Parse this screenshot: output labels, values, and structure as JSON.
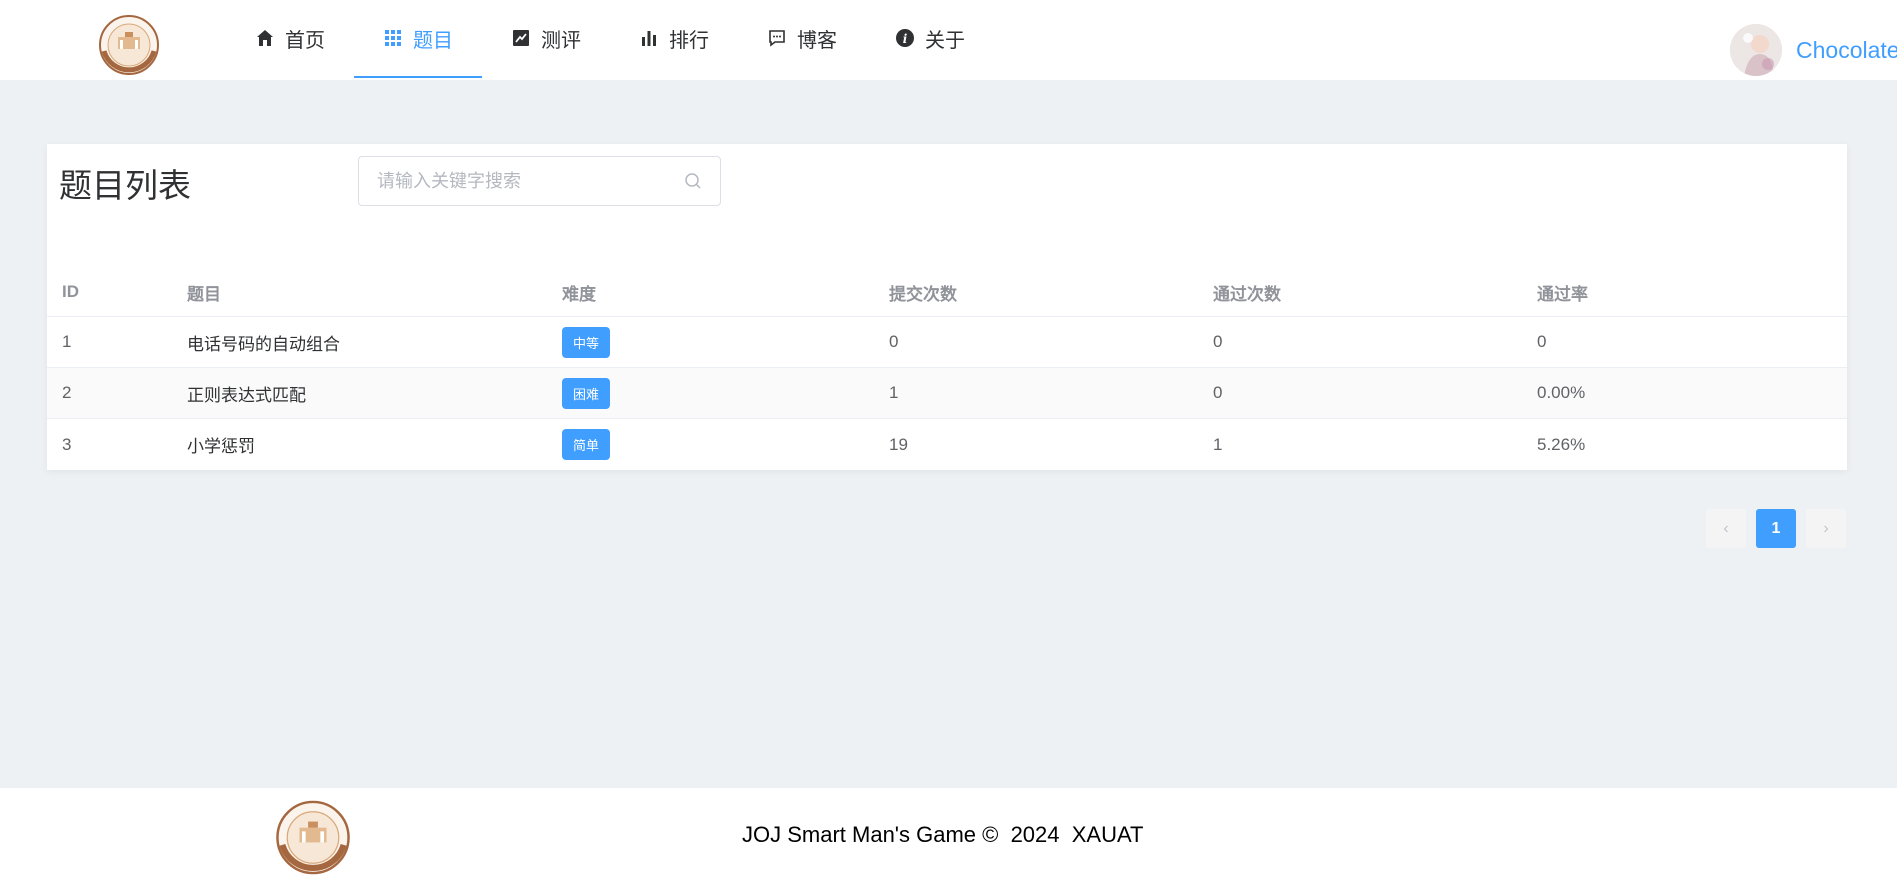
{
  "nav": [
    {
      "label": "首页",
      "icon": "home-icon",
      "active": false
    },
    {
      "label": "题目",
      "icon": "grid-icon",
      "active": true
    },
    {
      "label": "测评",
      "icon": "trend-chart-icon",
      "active": false
    },
    {
      "label": "排行",
      "icon": "bar-chart-icon",
      "active": false
    },
    {
      "label": "博客",
      "icon": "chat-bubble-icon",
      "active": false
    },
    {
      "label": "关于",
      "icon": "info-icon",
      "active": false
    }
  ],
  "user": {
    "name": "Chocolate"
  },
  "page": {
    "title": "题目列表",
    "search_placeholder": "请输入关键字搜索"
  },
  "table": {
    "headers": {
      "id": "ID",
      "title": "题目",
      "difficulty": "难度",
      "submissions": "提交次数",
      "accepted": "通过次数",
      "rate": "通过率"
    },
    "rows": [
      {
        "id": "1",
        "title": "电话号码的自动组合",
        "difficulty": "中等",
        "submissions": "0",
        "accepted": "0",
        "rate": "0"
      },
      {
        "id": "2",
        "title": "正则表达式匹配",
        "difficulty": "困难",
        "submissions": "1",
        "accepted": "0",
        "rate": "0.00%"
      },
      {
        "id": "3",
        "title": "小学惩罚",
        "difficulty": "简单",
        "submissions": "19",
        "accepted": "1",
        "rate": "5.26%"
      }
    ]
  },
  "pagination": {
    "current": "1",
    "prev": "‹",
    "next": "›"
  },
  "footer": {
    "text": "JOJ Smart Man's Game ©  2024  XAUAT"
  },
  "colors": {
    "accent": "#409eff",
    "background": "#eef1f4"
  }
}
